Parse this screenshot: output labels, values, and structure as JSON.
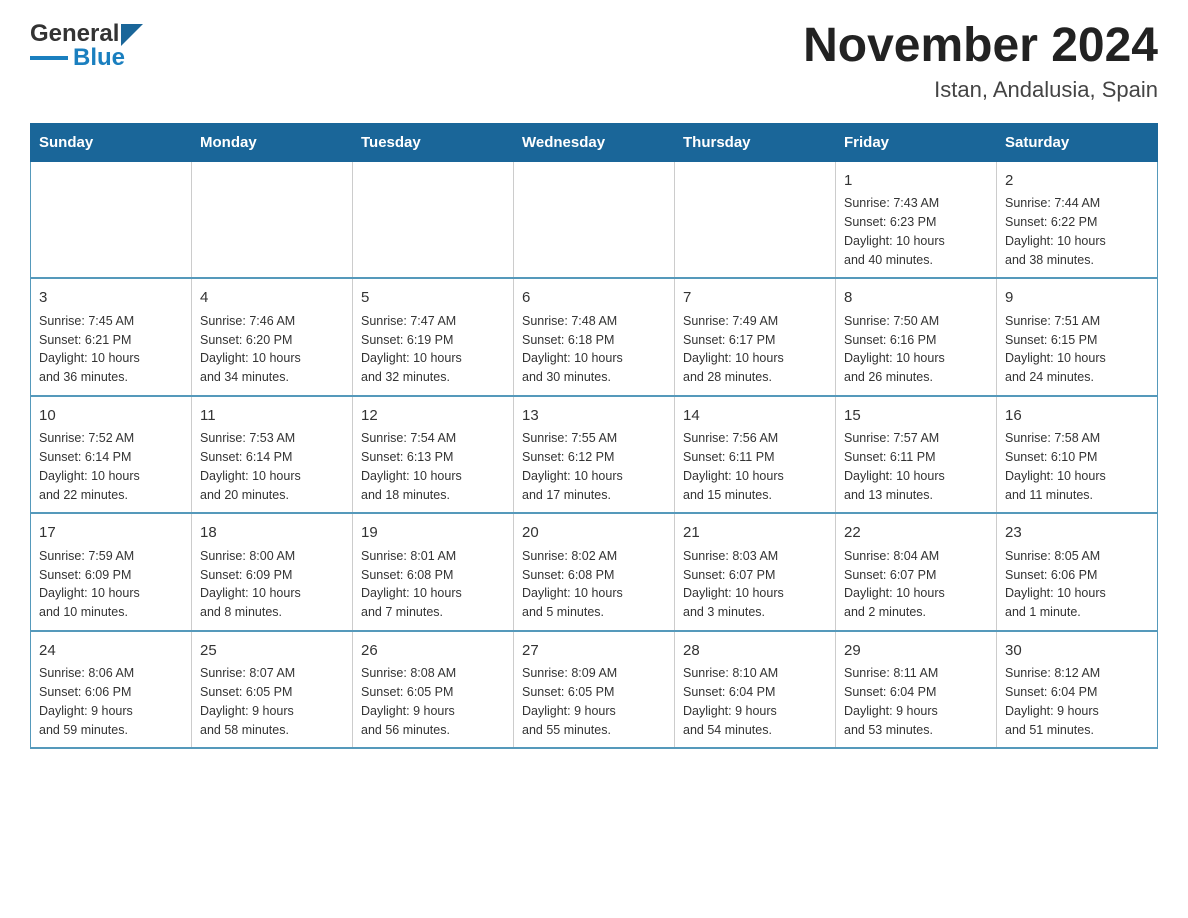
{
  "header": {
    "logo_general": "General",
    "logo_blue": "Blue",
    "title": "November 2024",
    "subtitle": "Istan, Andalusia, Spain"
  },
  "calendar": {
    "days_of_week": [
      "Sunday",
      "Monday",
      "Tuesday",
      "Wednesday",
      "Thursday",
      "Friday",
      "Saturday"
    ],
    "weeks": [
      [
        {
          "day": "",
          "content": ""
        },
        {
          "day": "",
          "content": ""
        },
        {
          "day": "",
          "content": ""
        },
        {
          "day": "",
          "content": ""
        },
        {
          "day": "",
          "content": ""
        },
        {
          "day": "1",
          "content": "Sunrise: 7:43 AM\nSunset: 6:23 PM\nDaylight: 10 hours\nand 40 minutes."
        },
        {
          "day": "2",
          "content": "Sunrise: 7:44 AM\nSunset: 6:22 PM\nDaylight: 10 hours\nand 38 minutes."
        }
      ],
      [
        {
          "day": "3",
          "content": "Sunrise: 7:45 AM\nSunset: 6:21 PM\nDaylight: 10 hours\nand 36 minutes."
        },
        {
          "day": "4",
          "content": "Sunrise: 7:46 AM\nSunset: 6:20 PM\nDaylight: 10 hours\nand 34 minutes."
        },
        {
          "day": "5",
          "content": "Sunrise: 7:47 AM\nSunset: 6:19 PM\nDaylight: 10 hours\nand 32 minutes."
        },
        {
          "day": "6",
          "content": "Sunrise: 7:48 AM\nSunset: 6:18 PM\nDaylight: 10 hours\nand 30 minutes."
        },
        {
          "day": "7",
          "content": "Sunrise: 7:49 AM\nSunset: 6:17 PM\nDaylight: 10 hours\nand 28 minutes."
        },
        {
          "day": "8",
          "content": "Sunrise: 7:50 AM\nSunset: 6:16 PM\nDaylight: 10 hours\nand 26 minutes."
        },
        {
          "day": "9",
          "content": "Sunrise: 7:51 AM\nSunset: 6:15 PM\nDaylight: 10 hours\nand 24 minutes."
        }
      ],
      [
        {
          "day": "10",
          "content": "Sunrise: 7:52 AM\nSunset: 6:14 PM\nDaylight: 10 hours\nand 22 minutes."
        },
        {
          "day": "11",
          "content": "Sunrise: 7:53 AM\nSunset: 6:14 PM\nDaylight: 10 hours\nand 20 minutes."
        },
        {
          "day": "12",
          "content": "Sunrise: 7:54 AM\nSunset: 6:13 PM\nDaylight: 10 hours\nand 18 minutes."
        },
        {
          "day": "13",
          "content": "Sunrise: 7:55 AM\nSunset: 6:12 PM\nDaylight: 10 hours\nand 17 minutes."
        },
        {
          "day": "14",
          "content": "Sunrise: 7:56 AM\nSunset: 6:11 PM\nDaylight: 10 hours\nand 15 minutes."
        },
        {
          "day": "15",
          "content": "Sunrise: 7:57 AM\nSunset: 6:11 PM\nDaylight: 10 hours\nand 13 minutes."
        },
        {
          "day": "16",
          "content": "Sunrise: 7:58 AM\nSunset: 6:10 PM\nDaylight: 10 hours\nand 11 minutes."
        }
      ],
      [
        {
          "day": "17",
          "content": "Sunrise: 7:59 AM\nSunset: 6:09 PM\nDaylight: 10 hours\nand 10 minutes."
        },
        {
          "day": "18",
          "content": "Sunrise: 8:00 AM\nSunset: 6:09 PM\nDaylight: 10 hours\nand 8 minutes."
        },
        {
          "day": "19",
          "content": "Sunrise: 8:01 AM\nSunset: 6:08 PM\nDaylight: 10 hours\nand 7 minutes."
        },
        {
          "day": "20",
          "content": "Sunrise: 8:02 AM\nSunset: 6:08 PM\nDaylight: 10 hours\nand 5 minutes."
        },
        {
          "day": "21",
          "content": "Sunrise: 8:03 AM\nSunset: 6:07 PM\nDaylight: 10 hours\nand 3 minutes."
        },
        {
          "day": "22",
          "content": "Sunrise: 8:04 AM\nSunset: 6:07 PM\nDaylight: 10 hours\nand 2 minutes."
        },
        {
          "day": "23",
          "content": "Sunrise: 8:05 AM\nSunset: 6:06 PM\nDaylight: 10 hours\nand 1 minute."
        }
      ],
      [
        {
          "day": "24",
          "content": "Sunrise: 8:06 AM\nSunset: 6:06 PM\nDaylight: 9 hours\nand 59 minutes."
        },
        {
          "day": "25",
          "content": "Sunrise: 8:07 AM\nSunset: 6:05 PM\nDaylight: 9 hours\nand 58 minutes."
        },
        {
          "day": "26",
          "content": "Sunrise: 8:08 AM\nSunset: 6:05 PM\nDaylight: 9 hours\nand 56 minutes."
        },
        {
          "day": "27",
          "content": "Sunrise: 8:09 AM\nSunset: 6:05 PM\nDaylight: 9 hours\nand 55 minutes."
        },
        {
          "day": "28",
          "content": "Sunrise: 8:10 AM\nSunset: 6:04 PM\nDaylight: 9 hours\nand 54 minutes."
        },
        {
          "day": "29",
          "content": "Sunrise: 8:11 AM\nSunset: 6:04 PM\nDaylight: 9 hours\nand 53 minutes."
        },
        {
          "day": "30",
          "content": "Sunrise: 8:12 AM\nSunset: 6:04 PM\nDaylight: 9 hours\nand 51 minutes."
        }
      ]
    ]
  }
}
